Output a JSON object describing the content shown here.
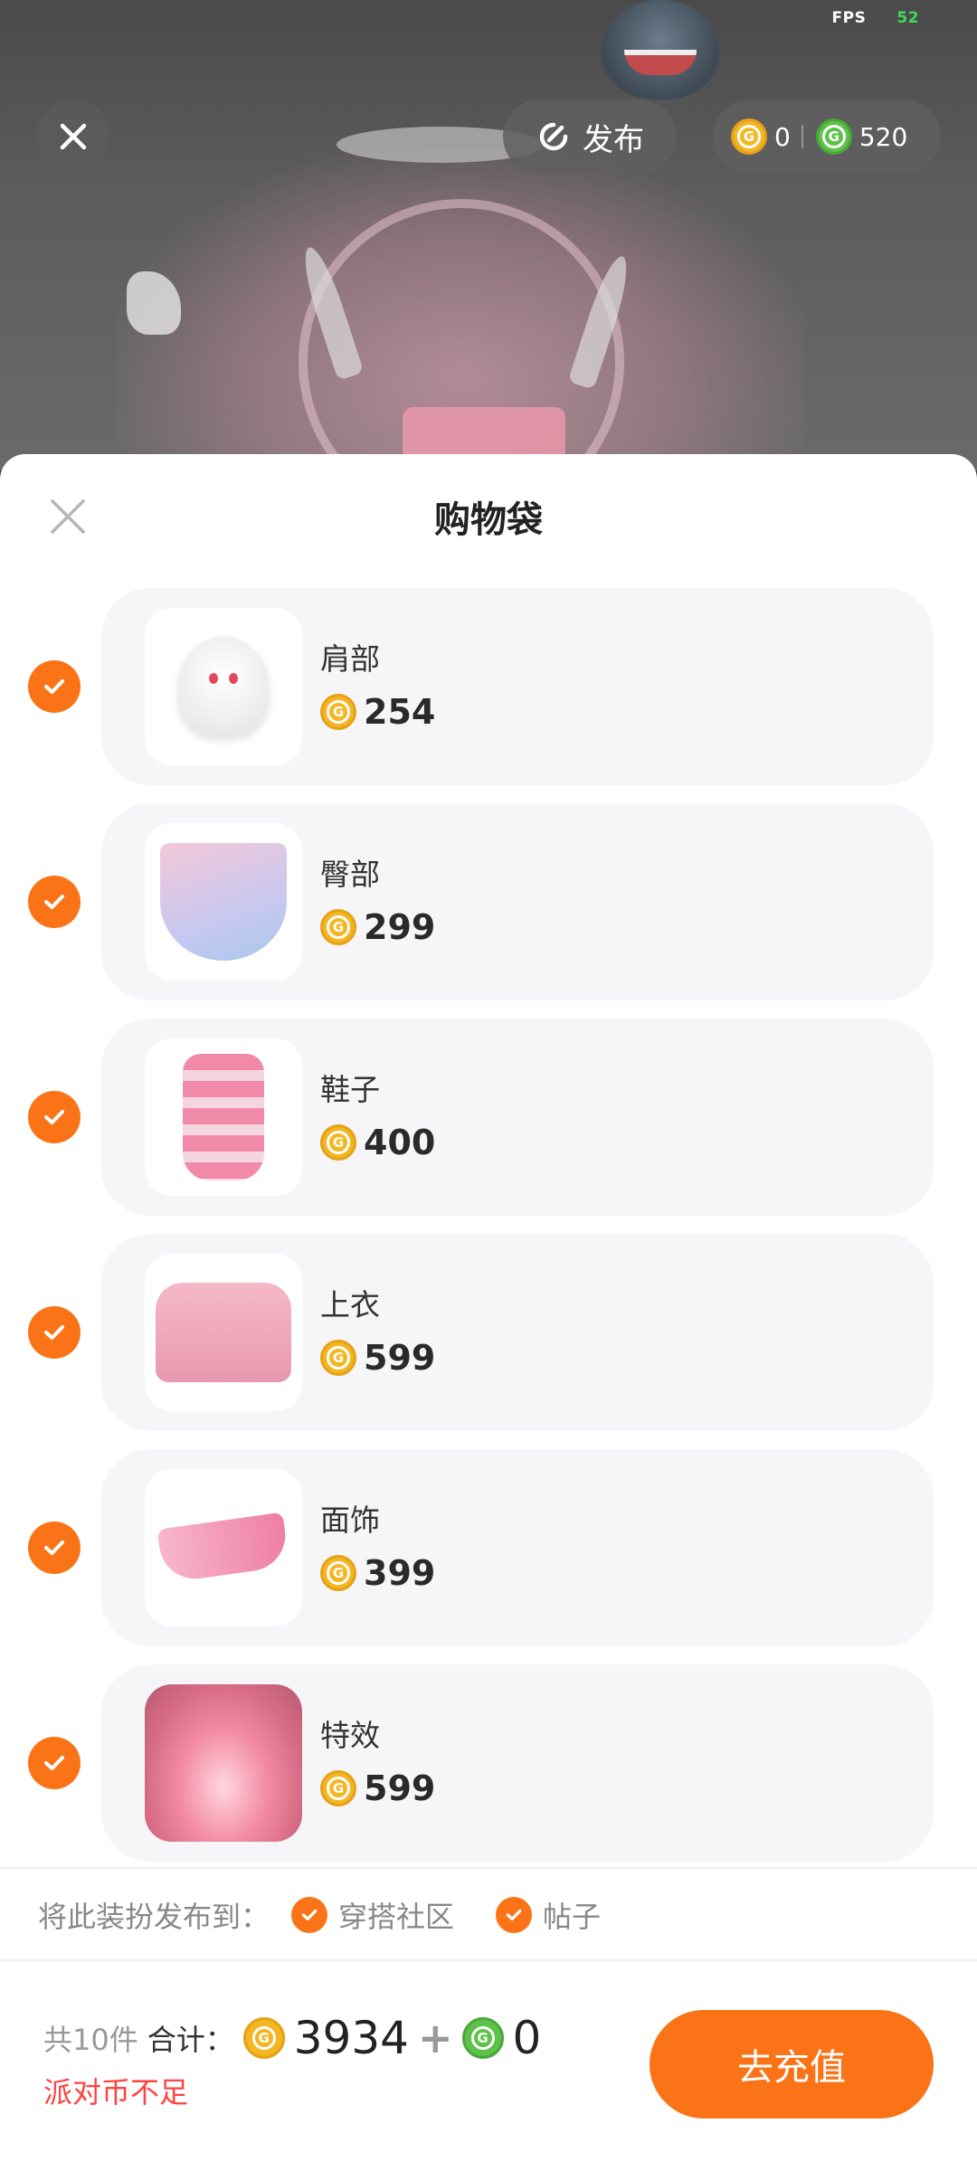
{
  "status": {
    "fps_label": "FPS",
    "fps_value": "52"
  },
  "topbar": {
    "publish_label": "发布",
    "gold_balance": "0",
    "green_balance": "520"
  },
  "sheet": {
    "title": "购物袋",
    "items": [
      {
        "name": "肩部",
        "price": "254",
        "thumb_icon": "ghost-shoulder-accessory"
      },
      {
        "name": "臀部",
        "price": "299",
        "thumb_icon": "bow-skirt"
      },
      {
        "name": "鞋子",
        "price": "400",
        "thumb_icon": "striped-boots"
      },
      {
        "name": "上衣",
        "price": "599",
        "thumb_icon": "pink-jacket"
      },
      {
        "name": "面饰",
        "price": "399",
        "thumb_icon": "pink-face-mask"
      },
      {
        "name": "特效",
        "price": "599",
        "thumb_icon": "pink-circle-effect"
      }
    ],
    "publish_to_label": "将此装扮发布到：",
    "publish_options": [
      "穿搭社区",
      "帖子"
    ]
  },
  "footer": {
    "count_text": "共10件",
    "total_label": "合计：",
    "gold_total": "3934",
    "plus": "+",
    "green_total": "0",
    "warning": "派对币不足",
    "recharge_label": "去充值"
  },
  "colors": {
    "accent": "#fa7417",
    "warning": "#ff4242",
    "gold": "#f4b623",
    "green": "#5ec24a"
  }
}
